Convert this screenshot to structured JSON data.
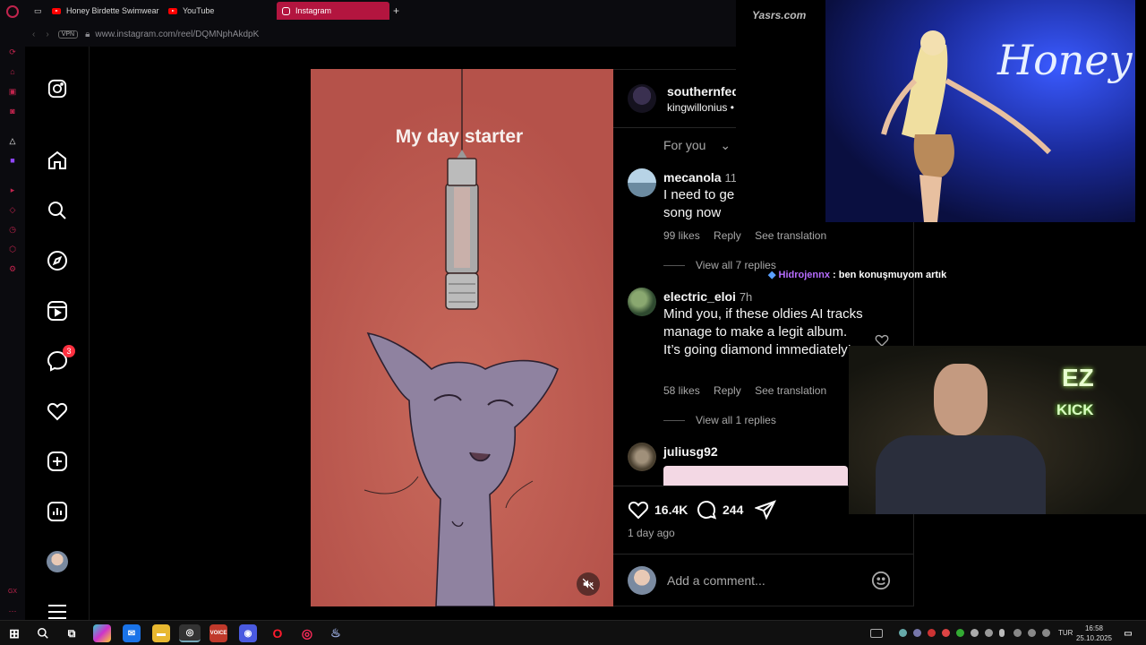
{
  "browser": {
    "tabs": [
      {
        "label": "Honey Birdette Swimwear"
      },
      {
        "label": "YouTube"
      },
      {
        "label": "Instagram"
      }
    ],
    "new_tab_label": "+",
    "vpn_label": "VPN",
    "url": "www.instagram.com/reel/DQMNphAkdpK"
  },
  "nav": {
    "messages_badge": "3"
  },
  "reel": {
    "caption": "My day starter"
  },
  "post": {
    "author": "southernfed",
    "subtitle": "kingwillonius •",
    "sort_label": "For you",
    "likes": "16.4K",
    "comments": "244",
    "posted": "1 day ago",
    "comment_placeholder": "Add a comment..."
  },
  "comments": [
    {
      "user": "mecanola",
      "time": "11",
      "text": "I need to ge song now",
      "likes": "99 likes",
      "reply": "Reply",
      "translate": "See translation",
      "view_replies": "View all 7 replies"
    },
    {
      "user": "electric_eloi",
      "time": "7h",
      "text": "Mind you, if these oldies AI tracks manage to make a legit album. It’s going diamond immediately!",
      "likes": "58 likes",
      "reply": "Reply",
      "translate": "See translation",
      "view_replies": "View all 1 replies"
    },
    {
      "user": "juliusg92"
    }
  ],
  "stream": {
    "overlay_text": "Honey",
    "watermark": "Yasrs.com",
    "chat_user": "Hidrojennx",
    "chat_text": ": ben konuşmuyom artık",
    "neon_top": "EZ",
    "neon_bottom": "KICK"
  },
  "taskbar": {
    "lang": "TUR",
    "time": "16:58",
    "date": "25.10.2025"
  },
  "colors": {
    "opera_red": "#c0244d",
    "active_tab": "#b3153f",
    "reel_bg": "#bf5a50",
    "badge": "#ff3040",
    "chat_name": "#b66cff"
  }
}
